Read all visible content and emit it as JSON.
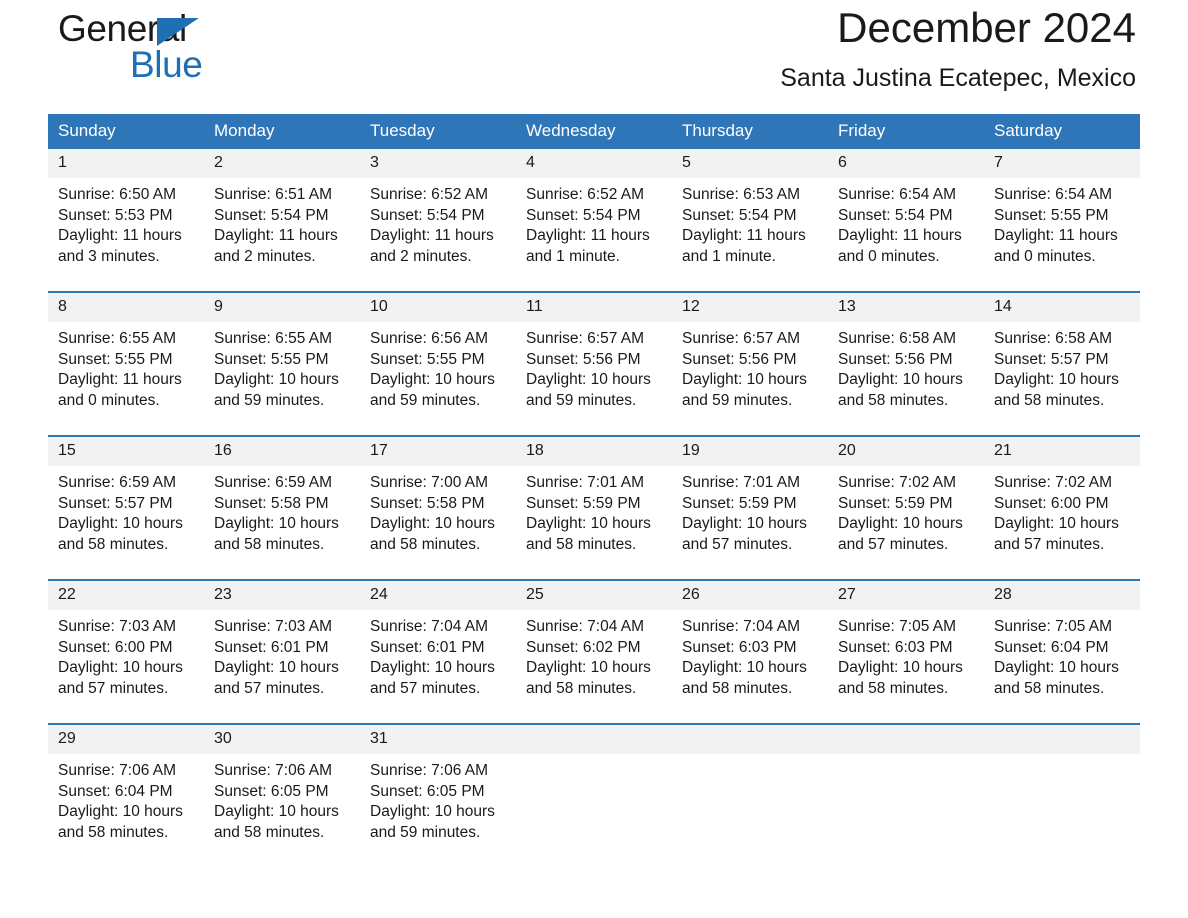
{
  "brand": {
    "name_part1": "General",
    "name_part2": "Blue",
    "accent_color": "#2e76b8"
  },
  "header": {
    "title": "December 2024",
    "subtitle": "Santa Justina Ecatepec, Mexico"
  },
  "calendar": {
    "weekday_headers": [
      "Sunday",
      "Monday",
      "Tuesday",
      "Wednesday",
      "Thursday",
      "Friday",
      "Saturday"
    ],
    "labels": {
      "sunrise": "Sunrise:",
      "sunset": "Sunset:",
      "daylight": "Daylight:"
    },
    "weeks": [
      [
        {
          "day": "1",
          "sunrise": "Sunrise: 6:50 AM",
          "sunset": "Sunset: 5:53 PM",
          "daylight_line1": "Daylight: 11 hours",
          "daylight_line2": "and 3 minutes."
        },
        {
          "day": "2",
          "sunrise": "Sunrise: 6:51 AM",
          "sunset": "Sunset: 5:54 PM",
          "daylight_line1": "Daylight: 11 hours",
          "daylight_line2": "and 2 minutes."
        },
        {
          "day": "3",
          "sunrise": "Sunrise: 6:52 AM",
          "sunset": "Sunset: 5:54 PM",
          "daylight_line1": "Daylight: 11 hours",
          "daylight_line2": "and 2 minutes."
        },
        {
          "day": "4",
          "sunrise": "Sunrise: 6:52 AM",
          "sunset": "Sunset: 5:54 PM",
          "daylight_line1": "Daylight: 11 hours",
          "daylight_line2": "and 1 minute."
        },
        {
          "day": "5",
          "sunrise": "Sunrise: 6:53 AM",
          "sunset": "Sunset: 5:54 PM",
          "daylight_line1": "Daylight: 11 hours",
          "daylight_line2": "and 1 minute."
        },
        {
          "day": "6",
          "sunrise": "Sunrise: 6:54 AM",
          "sunset": "Sunset: 5:54 PM",
          "daylight_line1": "Daylight: 11 hours",
          "daylight_line2": "and 0 minutes."
        },
        {
          "day": "7",
          "sunrise": "Sunrise: 6:54 AM",
          "sunset": "Sunset: 5:55 PM",
          "daylight_line1": "Daylight: 11 hours",
          "daylight_line2": "and 0 minutes."
        }
      ],
      [
        {
          "day": "8",
          "sunrise": "Sunrise: 6:55 AM",
          "sunset": "Sunset: 5:55 PM",
          "daylight_line1": "Daylight: 11 hours",
          "daylight_line2": "and 0 minutes."
        },
        {
          "day": "9",
          "sunrise": "Sunrise: 6:55 AM",
          "sunset": "Sunset: 5:55 PM",
          "daylight_line1": "Daylight: 10 hours",
          "daylight_line2": "and 59 minutes."
        },
        {
          "day": "10",
          "sunrise": "Sunrise: 6:56 AM",
          "sunset": "Sunset: 5:55 PM",
          "daylight_line1": "Daylight: 10 hours",
          "daylight_line2": "and 59 minutes."
        },
        {
          "day": "11",
          "sunrise": "Sunrise: 6:57 AM",
          "sunset": "Sunset: 5:56 PM",
          "daylight_line1": "Daylight: 10 hours",
          "daylight_line2": "and 59 minutes."
        },
        {
          "day": "12",
          "sunrise": "Sunrise: 6:57 AM",
          "sunset": "Sunset: 5:56 PM",
          "daylight_line1": "Daylight: 10 hours",
          "daylight_line2": "and 59 minutes."
        },
        {
          "day": "13",
          "sunrise": "Sunrise: 6:58 AM",
          "sunset": "Sunset: 5:56 PM",
          "daylight_line1": "Daylight: 10 hours",
          "daylight_line2": "and 58 minutes."
        },
        {
          "day": "14",
          "sunrise": "Sunrise: 6:58 AM",
          "sunset": "Sunset: 5:57 PM",
          "daylight_line1": "Daylight: 10 hours",
          "daylight_line2": "and 58 minutes."
        }
      ],
      [
        {
          "day": "15",
          "sunrise": "Sunrise: 6:59 AM",
          "sunset": "Sunset: 5:57 PM",
          "daylight_line1": "Daylight: 10 hours",
          "daylight_line2": "and 58 minutes."
        },
        {
          "day": "16",
          "sunrise": "Sunrise: 6:59 AM",
          "sunset": "Sunset: 5:58 PM",
          "daylight_line1": "Daylight: 10 hours",
          "daylight_line2": "and 58 minutes."
        },
        {
          "day": "17",
          "sunrise": "Sunrise: 7:00 AM",
          "sunset": "Sunset: 5:58 PM",
          "daylight_line1": "Daylight: 10 hours",
          "daylight_line2": "and 58 minutes."
        },
        {
          "day": "18",
          "sunrise": "Sunrise: 7:01 AM",
          "sunset": "Sunset: 5:59 PM",
          "daylight_line1": "Daylight: 10 hours",
          "daylight_line2": "and 58 minutes."
        },
        {
          "day": "19",
          "sunrise": "Sunrise: 7:01 AM",
          "sunset": "Sunset: 5:59 PM",
          "daylight_line1": "Daylight: 10 hours",
          "daylight_line2": "and 57 minutes."
        },
        {
          "day": "20",
          "sunrise": "Sunrise: 7:02 AM",
          "sunset": "Sunset: 5:59 PM",
          "daylight_line1": "Daylight: 10 hours",
          "daylight_line2": "and 57 minutes."
        },
        {
          "day": "21",
          "sunrise": "Sunrise: 7:02 AM",
          "sunset": "Sunset: 6:00 PM",
          "daylight_line1": "Daylight: 10 hours",
          "daylight_line2": "and 57 minutes."
        }
      ],
      [
        {
          "day": "22",
          "sunrise": "Sunrise: 7:03 AM",
          "sunset": "Sunset: 6:00 PM",
          "daylight_line1": "Daylight: 10 hours",
          "daylight_line2": "and 57 minutes."
        },
        {
          "day": "23",
          "sunrise": "Sunrise: 7:03 AM",
          "sunset": "Sunset: 6:01 PM",
          "daylight_line1": "Daylight: 10 hours",
          "daylight_line2": "and 57 minutes."
        },
        {
          "day": "24",
          "sunrise": "Sunrise: 7:04 AM",
          "sunset": "Sunset: 6:01 PM",
          "daylight_line1": "Daylight: 10 hours",
          "daylight_line2": "and 57 minutes."
        },
        {
          "day": "25",
          "sunrise": "Sunrise: 7:04 AM",
          "sunset": "Sunset: 6:02 PM",
          "daylight_line1": "Daylight: 10 hours",
          "daylight_line2": "and 58 minutes."
        },
        {
          "day": "26",
          "sunrise": "Sunrise: 7:04 AM",
          "sunset": "Sunset: 6:03 PM",
          "daylight_line1": "Daylight: 10 hours",
          "daylight_line2": "and 58 minutes."
        },
        {
          "day": "27",
          "sunrise": "Sunrise: 7:05 AM",
          "sunset": "Sunset: 6:03 PM",
          "daylight_line1": "Daylight: 10 hours",
          "daylight_line2": "and 58 minutes."
        },
        {
          "day": "28",
          "sunrise": "Sunrise: 7:05 AM",
          "sunset": "Sunset: 6:04 PM",
          "daylight_line1": "Daylight: 10 hours",
          "daylight_line2": "and 58 minutes."
        }
      ],
      [
        {
          "day": "29",
          "sunrise": "Sunrise: 7:06 AM",
          "sunset": "Sunset: 6:04 PM",
          "daylight_line1": "Daylight: 10 hours",
          "daylight_line2": "and 58 minutes."
        },
        {
          "day": "30",
          "sunrise": "Sunrise: 7:06 AM",
          "sunset": "Sunset: 6:05 PM",
          "daylight_line1": "Daylight: 10 hours",
          "daylight_line2": "and 58 minutes."
        },
        {
          "day": "31",
          "sunrise": "Sunrise: 7:06 AM",
          "sunset": "Sunset: 6:05 PM",
          "daylight_line1": "Daylight: 10 hours",
          "daylight_line2": "and 59 minutes."
        },
        {
          "day": "",
          "sunrise": "",
          "sunset": "",
          "daylight_line1": "",
          "daylight_line2": ""
        },
        {
          "day": "",
          "sunrise": "",
          "sunset": "",
          "daylight_line1": "",
          "daylight_line2": ""
        },
        {
          "day": "",
          "sunrise": "",
          "sunset": "",
          "daylight_line1": "",
          "daylight_line2": ""
        },
        {
          "day": "",
          "sunrise": "",
          "sunset": "",
          "daylight_line1": "",
          "daylight_line2": ""
        }
      ]
    ]
  }
}
